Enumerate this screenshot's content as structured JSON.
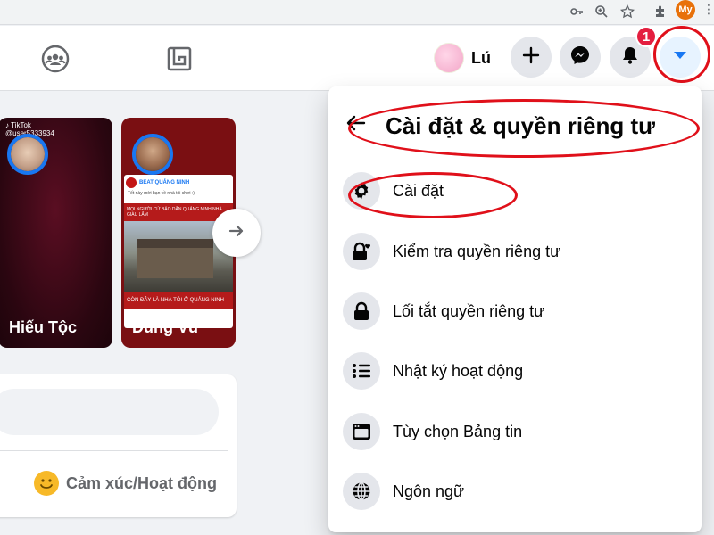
{
  "browser": {
    "profile_initials": "My",
    "icons": [
      "key-icon",
      "zoom-icon",
      "star-icon",
      "extensions-icon",
      "menu-kebab-icon"
    ]
  },
  "header": {
    "user_name": "Lú",
    "notification_count": "1",
    "nav_icons": [
      "groups-icon",
      "gaming-icon"
    ],
    "action_icons": [
      "plus-icon",
      "messenger-icon",
      "bell-icon",
      "caret-down-icon"
    ],
    "accent": "#1877f2",
    "badge_color": "#e41e3f"
  },
  "stories": [
    {
      "name": "Hiếu Tộc",
      "overlay": "TikTok",
      "handle": "@user5333934"
    },
    {
      "name": "Dũng Vũ",
      "page": "BEAT QUẢNG NINH",
      "caption": "Tết này mời bạn về nhà tôi chơi :)",
      "headline": "MỌI NGƯỜI CỨ BẢO DÂN QUẢNG NINH NHÀ GIÀU LẮM",
      "footer": "CÒN ĐÂY LÀ NHÀ TÔI Ở QUẢNG NINH"
    }
  ],
  "composer": {
    "feeling_label": "Cảm xúc/Hoạt động"
  },
  "menu": {
    "title": "Cài đặt & quyền riêng tư",
    "items": [
      {
        "label": "Cài đặt",
        "icon": "gear-icon"
      },
      {
        "label": "Kiểm tra quyền riêng tư",
        "icon": "lock-heart-icon"
      },
      {
        "label": "Lối tắt quyền riêng tư",
        "icon": "lock-icon"
      },
      {
        "label": "Nhật ký hoạt động",
        "icon": "list-icon"
      },
      {
        "label": "Tùy chọn Bảng tin",
        "icon": "feed-icon"
      },
      {
        "label": "Ngôn ngữ",
        "icon": "globe-icon"
      }
    ]
  },
  "annotation_color": "#e0101a"
}
